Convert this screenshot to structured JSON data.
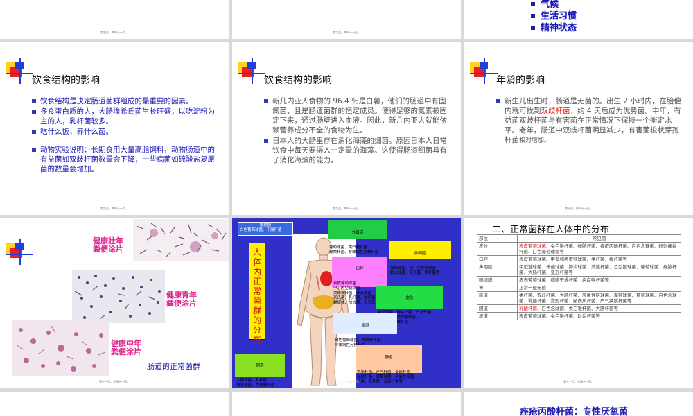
{
  "page_numbers": {
    "s1": "第五页，共四十一页。",
    "s2": "第六页，共四十一页。",
    "s4": "第九页，共四十一页。",
    "s5": "第九页，共四十一页。",
    "s6": "第十页，共四十一页。",
    "s7": "第十一页，共四十一页。",
    "s8": "第十二页，共四十一页。",
    "s9": "第十三页，共四十一页。"
  },
  "slide3": {
    "items": [
      "气候",
      "生活习惯",
      "精神状态"
    ]
  },
  "slide4": {
    "title": "饮食结构的影响",
    "b1": "饮食结构是决定肠道菌群组成的最重要的因素。",
    "b2": "多食蛋白质的人，大肠埃希氏菌生长旺盛；以吃淀粉为主的人，乳杆菌较多。",
    "b3": "吃什么饭，养什么菌。",
    "b4": "动物实验说明：长期食用大量高脂饲料，动物肠道中的有益菌如双歧杆菌数量会下降，一些病菌如硫酸盐复原菌的数量会增加。"
  },
  "slide5": {
    "title": "饮食结构的影响",
    "b1": "新几内亚人食物的 96.4 ％是白薯，他们的肠道中有固氮菌，且是肠道菌群的恒定成员。使得足够的氮素被固定下来，通过肠壁进入血液。因此，新几内亚人就能依赖营养成分不全的食物为生。",
    "b2": "日本人的大肠里存在消化海藻的细菌。原因日本人日常饮食中每天要摄入一定量的海藻。这使得肠道细菌具有了消化海藻的能力。"
  },
  "slide6": {
    "title": "年龄的影响",
    "b1_pre": "新生儿出生时，肠道是无菌的。出生 2 小时内，在胎便内就可找到",
    "b1_red": "双歧杆菌",
    "b1_post": "，约 4 天后成为优势菌。中年，有益菌双歧杆菌与有害菌在正常情况下保持一个衡定水平。老年，肠道中双歧杆菌明显减少，有害菌梭状芽孢杆菌",
    "b1_tail": "相对增加。"
  },
  "slide7": {
    "label_strong": "健康壮年\n粪便涂片",
    "label_young": "健康青年\n粪便涂片",
    "label_middle": "健康中年\n粪便涂片",
    "caption": "肠道的正常菌群"
  },
  "slide8": {
    "vertical_title": "人体内正常菌群的分布",
    "eye_title": "眼结膜",
    "eye_body": "白色葡萄球菌、干燥杆菌",
    "ear_title": "外耳道",
    "ear_body": "葡萄球菌、类白喉杆菌\n绿脓杆菌、非致病性分枝杆菌",
    "nose_title": "鼻咽腔",
    "nose_body": "葡萄球菌、甲、丙型链球菌\n肺炎球菌、奈氏菌、类杆菌等",
    "mouth_title": "口腔",
    "mouth_body": "表皮葡萄球菌\n甲、丙型链球菌\n类白喉杆菌、肺炎球菌\n奈氏菌、乳杆菌、梭杆菌\n螺旋体、放线菌、白念珠菌",
    "skin_title": "皮肤",
    "skin_body": "葡萄球菌、绿脓杆菌、白念珠菌\n丙酸杆菌、类白喉杆菌、\n非致病性分枝杆菌",
    "urethra_title": "尿道",
    "urethra_body": "白色葡萄球菌、类白喉杆菌、\n非致病性分枝杆菌",
    "vagina_title": "阴道",
    "vagina_body": "大肠杆菌、乳杆菌\n白念珠菌、类白喉杆菌\n非致病性分枝等",
    "gut_title": "肠道",
    "gut_body": "大肠杆菌、产气杆菌、变形杆菌\n绿脓杆菌、葡萄球菌、厌氧性细菌\n真菌、乳杆菌、双歧杆菌等"
  },
  "slide9": {
    "title": "二、正常菌群在人体中的分布",
    "headers": [
      "部位",
      "常见菌"
    ],
    "rows": [
      {
        "site": "皮肤",
        "red": "表皮葡萄球菌",
        "text": "、类白喉杆菌、绿脓杆菌、痤疮丙酸杆菌、白色念珠菌、粉刺棒状杆菌、白色葡萄球菌等"
      },
      {
        "site": "口腔",
        "red": "",
        "text": "表皮葡萄球菌、甲型和丙型链球菌、类杆菌、梭杆菌等"
      },
      {
        "site": "鼻咽腔",
        "red": "",
        "text": "甲型链球菌、卡他球菌、肺炎球菌、流感杆菌、乙型链球菌、葡萄球菌、绿脓杆菌、大肠杆菌、变形杆菌等"
      },
      {
        "site": "眼结膜",
        "red": "",
        "text": "皮表葡萄球菌，结膜干燥杆菌、类白喉杆菌等"
      },
      {
        "site": "胃",
        "red": "",
        "text": "正常一般无菌"
      },
      {
        "site": "肠道",
        "red": "",
        "text": "类杆菌、双歧杆菌、大肠杆菌、厌氧性链球菌、粪链球菌、葡萄球菌、白色念球菌、乳酸杆菌、变形杆菌、破伤风杆菌、产气荚膜杆菌等"
      },
      {
        "site": "阴道",
        "red": "乳酸杆菌",
        "text": "、白色念球菌、类白喉杆菌、大肠杆菌等"
      },
      {
        "site": "尿道",
        "red": "",
        "text": "表皮葡萄球菌、类白喉杆菌、耻垢杆菌等"
      }
    ]
  },
  "slide12": {
    "title": "痤疮丙酸杆菌：专性厌氧菌"
  }
}
